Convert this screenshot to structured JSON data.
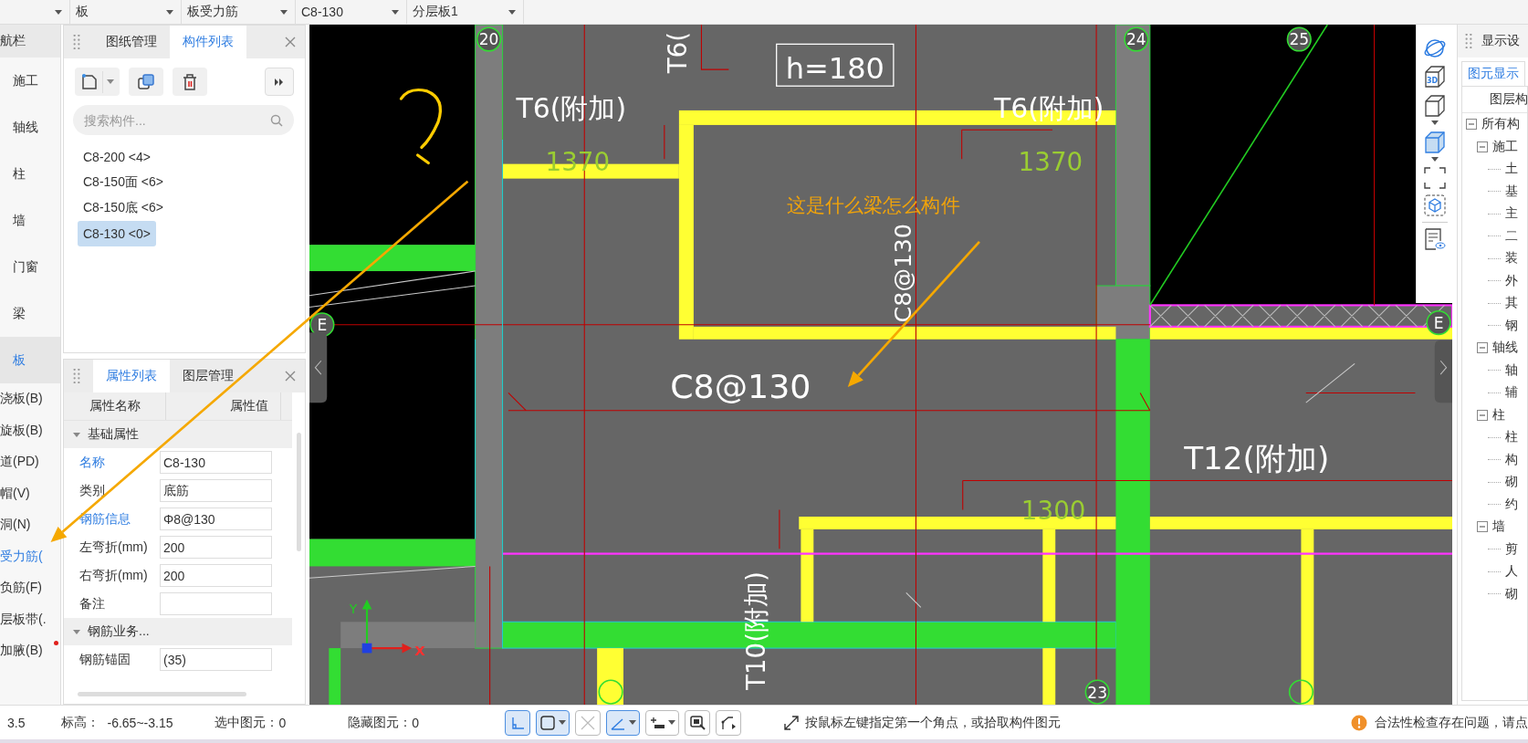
{
  "top_bar": {
    "dropdowns": [
      {
        "value": "板"
      },
      {
        "value": "板受力筋"
      },
      {
        "value": "C8-130"
      },
      {
        "value": "分层板1"
      }
    ]
  },
  "nav": {
    "title": "航栏",
    "items": [
      {
        "label": "施工",
        "kind": "category",
        "selected": false,
        "flagged": false
      },
      {
        "label": "轴线",
        "kind": "category",
        "selected": false,
        "flagged": false
      },
      {
        "label": "柱",
        "kind": "category",
        "selected": false,
        "flagged": false
      },
      {
        "label": "墙",
        "kind": "category",
        "selected": false,
        "flagged": false
      },
      {
        "label": "门窗",
        "kind": "category",
        "selected": false,
        "flagged": false
      },
      {
        "label": "梁",
        "kind": "category",
        "selected": false,
        "flagged": false
      },
      {
        "label": "板",
        "kind": "category",
        "selected": true,
        "flagged": false
      },
      {
        "label": "浇板(B)",
        "kind": "sub",
        "selected": false,
        "flagged": false
      },
      {
        "label": "旋板(B)",
        "kind": "sub",
        "selected": false,
        "flagged": false
      },
      {
        "label": "道(PD)",
        "kind": "sub",
        "selected": false,
        "flagged": false
      },
      {
        "label": "帽(V)",
        "kind": "sub",
        "selected": false,
        "flagged": false
      },
      {
        "label": "洞(N)",
        "kind": "sub",
        "selected": false,
        "flagged": false
      },
      {
        "label": "受力筋(",
        "kind": "sub",
        "selected": true,
        "flagged": false
      },
      {
        "label": "负筋(F)",
        "kind": "sub",
        "selected": false,
        "flagged": false
      },
      {
        "label": "层板带(.",
        "kind": "sub",
        "selected": false,
        "flagged": false
      },
      {
        "label": "加腋(B)",
        "kind": "sub",
        "selected": false,
        "flagged": true
      }
    ]
  },
  "parts_panel": {
    "tabs": [
      {
        "label": "图纸管理",
        "selected": false
      },
      {
        "label": "构件列表",
        "selected": true
      }
    ],
    "search": {
      "placeholder": "搜索构件..."
    },
    "items": [
      {
        "label": "C8-200 <4>",
        "selected": false
      },
      {
        "label": "C8-150面 <6>",
        "selected": false
      },
      {
        "label": "C8-150底 <6>",
        "selected": false
      },
      {
        "label": "C8-130 <0>",
        "selected": true
      }
    ]
  },
  "properties_panel": {
    "tabs": [
      {
        "label": "属性列表",
        "selected": true
      },
      {
        "label": "图层管理",
        "selected": false
      }
    ],
    "columns": [
      "属性名称",
      "属性值"
    ],
    "groups": [
      {
        "title": "基础属性",
        "expanded": true,
        "rows": [
          {
            "name": "名称",
            "value": "C8-130",
            "linked": true
          },
          {
            "name": "类别",
            "value": "底筋",
            "linked": false
          },
          {
            "name": "钢筋信息",
            "value": "Φ8@130",
            "linked": true
          },
          {
            "name": "左弯折(mm)",
            "value": "200",
            "linked": false
          },
          {
            "name": "右弯折(mm)",
            "value": "200",
            "linked": false
          },
          {
            "name": "备注",
            "linked": false
          }
        ]
      },
      {
        "title": "钢筋业务...",
        "expanded": true,
        "rows": [
          {
            "name": "钢筋锚固",
            "value": "(35)",
            "linked": false
          }
        ]
      }
    ]
  },
  "drawing": {
    "axis_labels": [
      "20",
      "24",
      "25",
      "E",
      "E",
      "23"
    ],
    "box_label": "h=180",
    "labels": [
      "T6(",
      "T6(附加)",
      "T6(附加)",
      "1370",
      "1370",
      "C8@130",
      "C8@130",
      "T12(附加)",
      "1300",
      "T10(附加)"
    ],
    "note": "这是什么梁怎么构件",
    "axis_x": "X",
    "axis_y": "Y"
  },
  "view_toolbar": {
    "cube_label": "3D"
  },
  "display_panel": {
    "title": "显示设",
    "tabs": [
      {
        "label": "图元显示",
        "selected": true
      }
    ],
    "column": "图层构",
    "tree": [
      {
        "label": "所有构",
        "expanded": true,
        "children": [
          {
            "label": "施工",
            "expanded": true,
            "children": [
              {
                "label": "土"
              },
              {
                "label": "基"
              },
              {
                "label": "主"
              },
              {
                "label": "二"
              },
              {
                "label": "装"
              },
              {
                "label": "外"
              },
              {
                "label": "其"
              },
              {
                "label": "钢"
              }
            ]
          },
          {
            "label": "轴线",
            "expanded": true,
            "children": [
              {
                "label": "轴"
              },
              {
                "label": "辅"
              }
            ]
          },
          {
            "label": "柱",
            "expanded": true,
            "children": [
              {
                "label": "柱"
              },
              {
                "label": "构"
              },
              {
                "label": "砌"
              },
              {
                "label": "约"
              }
            ]
          },
          {
            "label": "墙",
            "expanded": true,
            "children": [
              {
                "label": "剪"
              },
              {
                "label": "人"
              },
              {
                "label": "砌"
              }
            ]
          }
        ]
      }
    ]
  },
  "status_bar": {
    "scale": "3.5",
    "elevation_label": "标高：",
    "elevation": "-6.65~-3.15",
    "selected_label": "选中图元：",
    "selected_count": "0",
    "hidden_label": "隐藏图元：",
    "hidden_count": "0",
    "tools": [
      {
        "kind": "ortho",
        "selected": true,
        "dropdown": false
      },
      {
        "kind": "rect-select",
        "selected": true,
        "dropdown": true
      },
      {
        "kind": "cross",
        "selected": false,
        "dropdown": false
      },
      {
        "kind": "angle",
        "selected": true,
        "dropdown": true
      },
      {
        "kind": "dimension",
        "selected": false,
        "dropdown": true
      },
      {
        "kind": "screen",
        "selected": false,
        "dropdown": false
      },
      {
        "kind": "polyline",
        "selected": false,
        "dropdown": false
      }
    ],
    "hint": "按鼠标左键指定第一个角点，或拾取构件图元",
    "warning": "合法性检查存在问题，请点"
  }
}
